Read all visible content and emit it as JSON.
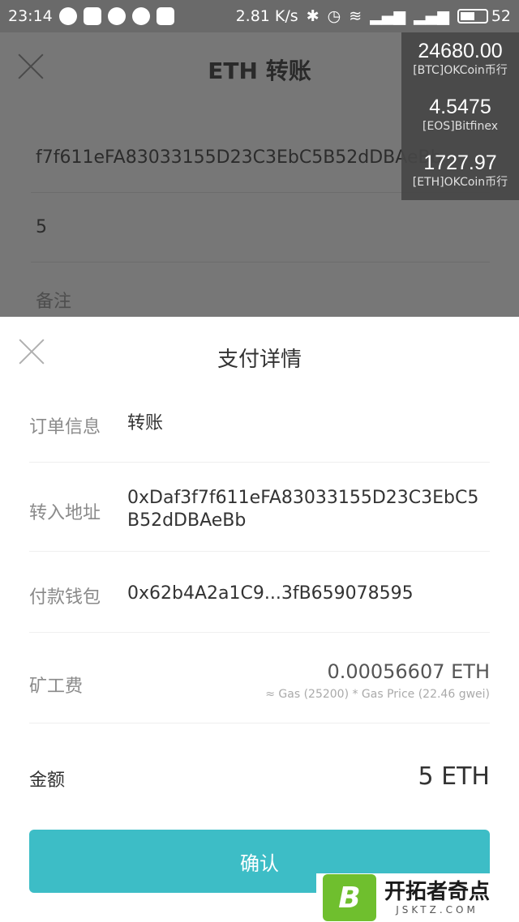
{
  "status_bar": {
    "time": "23:14",
    "network_speed": "2.81 K/s",
    "battery": "52"
  },
  "background_page": {
    "title": "ETH 转账",
    "address_value": "f7f611eFA83033155D23C3EbC5B52dDBAeBb",
    "amount_value": "5",
    "memo_placeholder": "备注"
  },
  "ticker": [
    {
      "price": "24680.00",
      "source": "[BTC]OKCoin币行"
    },
    {
      "price": "4.5475",
      "source": "[EOS]Bitfinex"
    },
    {
      "price": "1727.97",
      "source": "[ETH]OKCoin币行"
    }
  ],
  "sheet": {
    "title": "支付详情",
    "order_label": "订单信息",
    "order_value": "转账",
    "to_label": "转入地址",
    "to_value": "0xDaf3f7f611eFA83033155D23C3EbC5B52dDBAeBb",
    "from_label": "付款钱包",
    "from_value": "0x62b4A2a1C9...3fB659078595",
    "fee_label": "矿工费",
    "fee_value": "0.00056607 ETH",
    "fee_detail": "≈ Gas (25200) * Gas Price (22.46 gwei)",
    "total_label": "金额",
    "total_value": "5 ETH",
    "confirm_label": "确认"
  },
  "watermark": {
    "logo_letter": "B",
    "name": "开拓者奇点",
    "url": "JSKTZ.COM"
  },
  "colors": {
    "accent": "#3dbdc6",
    "overlay": "#777777"
  }
}
